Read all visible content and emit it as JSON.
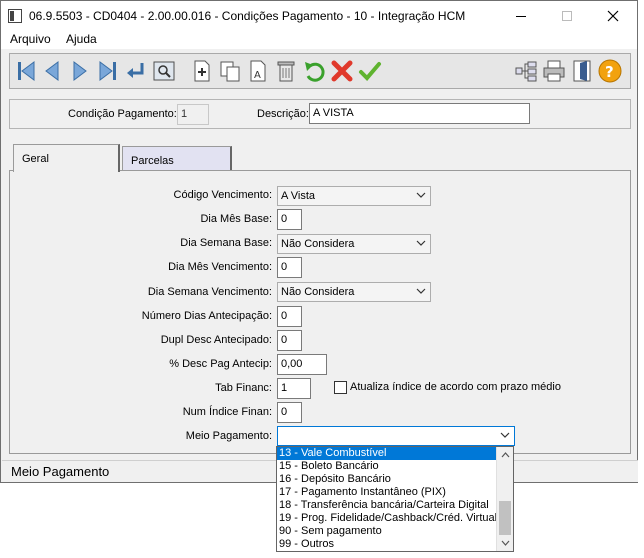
{
  "window": {
    "title": "06.9.5503 - CD0404 - 2.00.00.016 - Condições Pagamento - 10 - Integração HCM"
  },
  "menu": {
    "items": [
      "Arquivo",
      "Ajuda"
    ]
  },
  "toolbar": {
    "icons": [
      "first-record-icon",
      "previous-record-icon",
      "next-record-icon",
      "last-record-icon",
      "goto-icon",
      "search-icon",
      "new-icon",
      "copy-icon",
      "edit-icon",
      "delete-icon",
      "undo-icon",
      "cancel-icon",
      "save-icon",
      "tree-icon",
      "print-icon",
      "exit-icon",
      "help-icon"
    ]
  },
  "header": {
    "condicao_label": "Condição Pagamento:",
    "condicao_value": "1",
    "descricao_label": "Descrição:",
    "descricao_value": "A VISTA"
  },
  "tabs": [
    "Geral",
    "Parcelas"
  ],
  "form": {
    "codigo_vencimento_label": "Código Vencimento:",
    "codigo_vencimento_value": "A Vista",
    "dia_mes_base_label": "Dia Mês Base:",
    "dia_mes_base_value": "0",
    "dia_semana_base_label": "Dia Semana Base:",
    "dia_semana_base_value": "Não Considera",
    "dia_mes_vencimento_label": "Dia Mês Vencimento:",
    "dia_mes_vencimento_value": "0",
    "dia_semana_vencimento_label": "Dia Semana Vencimento:",
    "dia_semana_vencimento_value": "Não Considera",
    "numero_dias_antecipacao_label": "Número Dias Antecipação:",
    "numero_dias_antecipacao_value": "0",
    "dupl_desc_antecipado_label": "Dupl Desc Antecipado:",
    "dupl_desc_antecipado_value": "0",
    "desc_pag_antecip_label": "% Desc Pag Antecip:",
    "desc_pag_antecip_value": "0,00",
    "tab_financ_label": "Tab Financ:",
    "tab_financ_value": "1",
    "atualiza_indice_label": "Atualiza índice de acordo com prazo médio",
    "num_indice_finan_label": "Num Índice Finan:",
    "num_indice_finan_value": "0",
    "meio_pagamento_label": "Meio Pagamento:",
    "meio_pagamento_value": ""
  },
  "meio_pagamento_options": [
    "13 - Vale Combustível",
    "15 - Boleto Bancário",
    "16 - Depósito Bancário",
    "17 - Pagamento Instantâneo (PIX)",
    "18 - Transferência bancária/Carteira Digital",
    "19 - Prog. Fidelidade/Cashback/Créd. Virtual",
    "90 - Sem pagamento",
    "99 - Outros"
  ],
  "status": {
    "text": "Meio Pagamento"
  }
}
